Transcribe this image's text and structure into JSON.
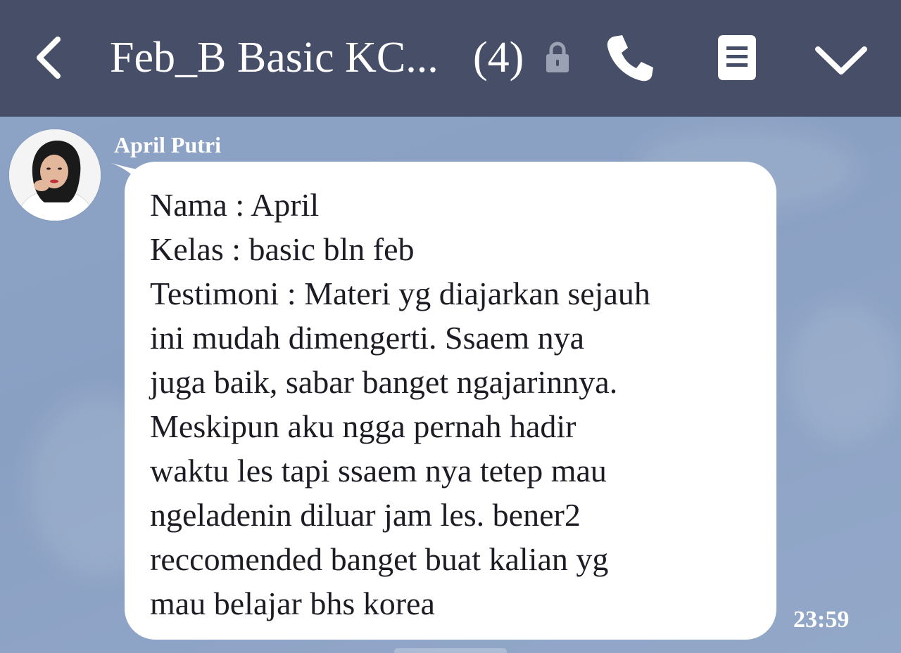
{
  "header": {
    "back_icon": "chevron-left-icon",
    "title": "Feb_B Basic KC...",
    "member_count": "(4)",
    "lock_icon": "lock-icon",
    "call_icon": "phone-icon",
    "notes_icon": "notes-icon",
    "menu_icon": "chevron-down-icon"
  },
  "message": {
    "sender": "April Putri",
    "avatar_icon": "user-avatar",
    "lines": [
      "Nama : April",
      "Kelas : basic bln feb",
      "Testimoni : Materi yg diajarkan sejauh",
      "ini mudah dimengerti. Ssaem nya",
      "juga baik, sabar banget ngajarinnya.",
      "Meskipun aku ngga pernah hadir",
      "waktu les tapi ssaem nya tetep mau",
      "ngeladenin diluar jam les. bener2",
      "reccomended banget buat kalian yg",
      "mau belajar bhs korea"
    ],
    "time": "23:59"
  },
  "colors": {
    "header_bg": "#474f68",
    "chat_bg": "#8ea4c6",
    "bubble_bg": "#ffffff",
    "text": "#1c1c24"
  }
}
